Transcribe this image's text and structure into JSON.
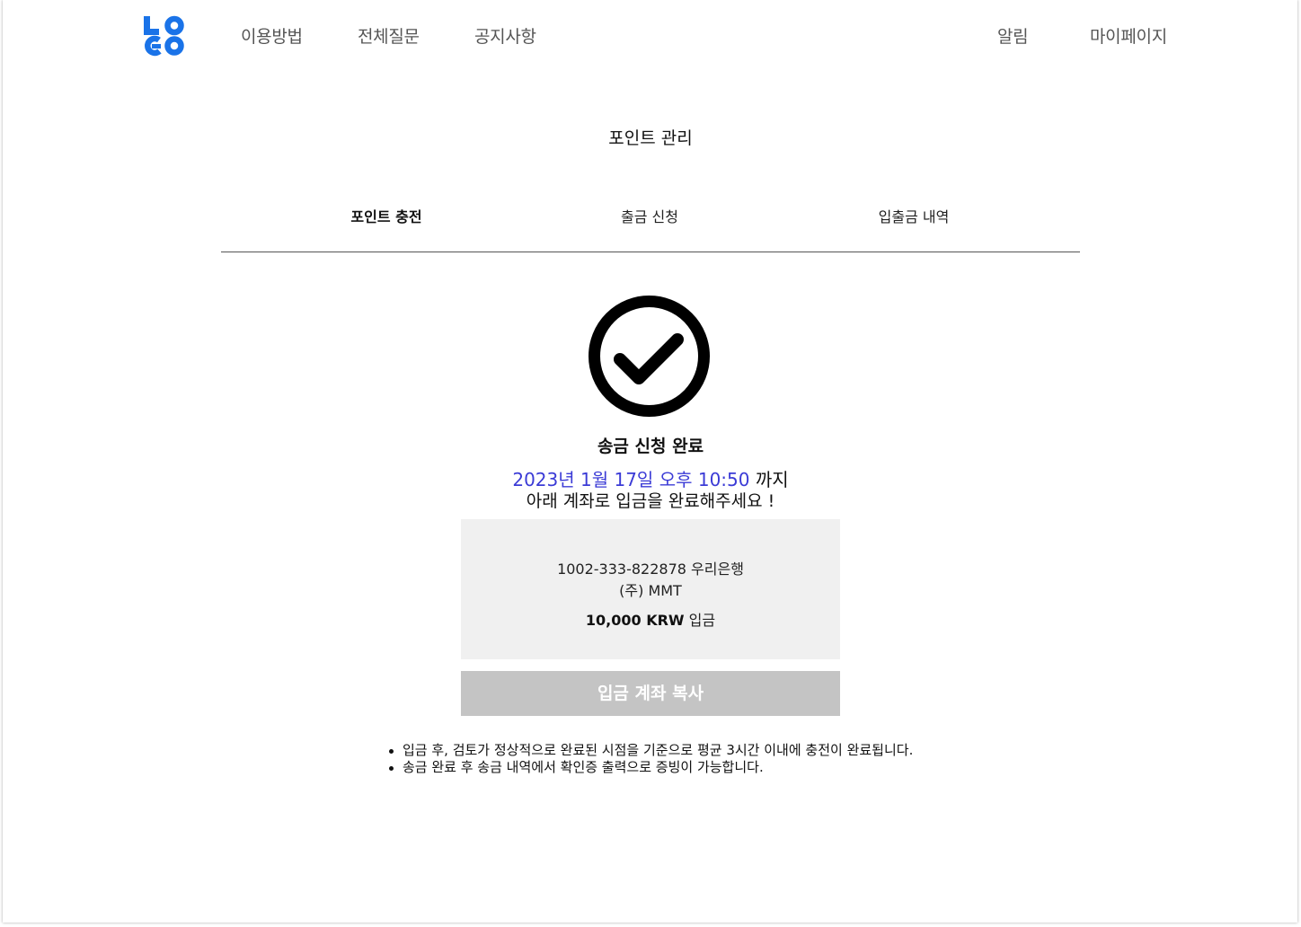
{
  "header": {
    "logo_text": "LOGO",
    "nav_left": [
      "이용방법",
      "전체질문",
      "공지사항"
    ],
    "nav_right": [
      "알림",
      "마이페이지"
    ]
  },
  "page": {
    "title": "포인트 관리"
  },
  "tabs": [
    {
      "label": "포인트 충전",
      "active": true
    },
    {
      "label": "출금 신청",
      "active": false
    },
    {
      "label": "입출금 내역",
      "active": false
    }
  ],
  "success": {
    "icon": "check-circle-icon",
    "title": "송금 신청 완료",
    "deadline": "2023년 1월 17일 오후 10:50",
    "deadline_suffix": "까지",
    "instruction": "아래 계좌로 입금을 완료해주세요 !"
  },
  "account": {
    "number_line": "1002-333-822878 우리은행",
    "holder": "(주) MMT",
    "amount": "10,000 KRW",
    "amount_suffix": "입금"
  },
  "copy_button_label": "입금 계좌 복사",
  "notes": [
    "입금 후, 검토가 정상적으로 완료된 시점을 기준으로 평균 3시간 이내에 충전이 완료됩니다.",
    "송금 완료 후 송금 내역에서 확인증 출력으로 증빙이 가능합니다."
  ],
  "colors": {
    "logo_blue": "#1a73e8",
    "deadline_blue": "#3b3bd6",
    "button_disabled": "#c4c4c4",
    "account_box_bg": "#f0f0f0"
  }
}
